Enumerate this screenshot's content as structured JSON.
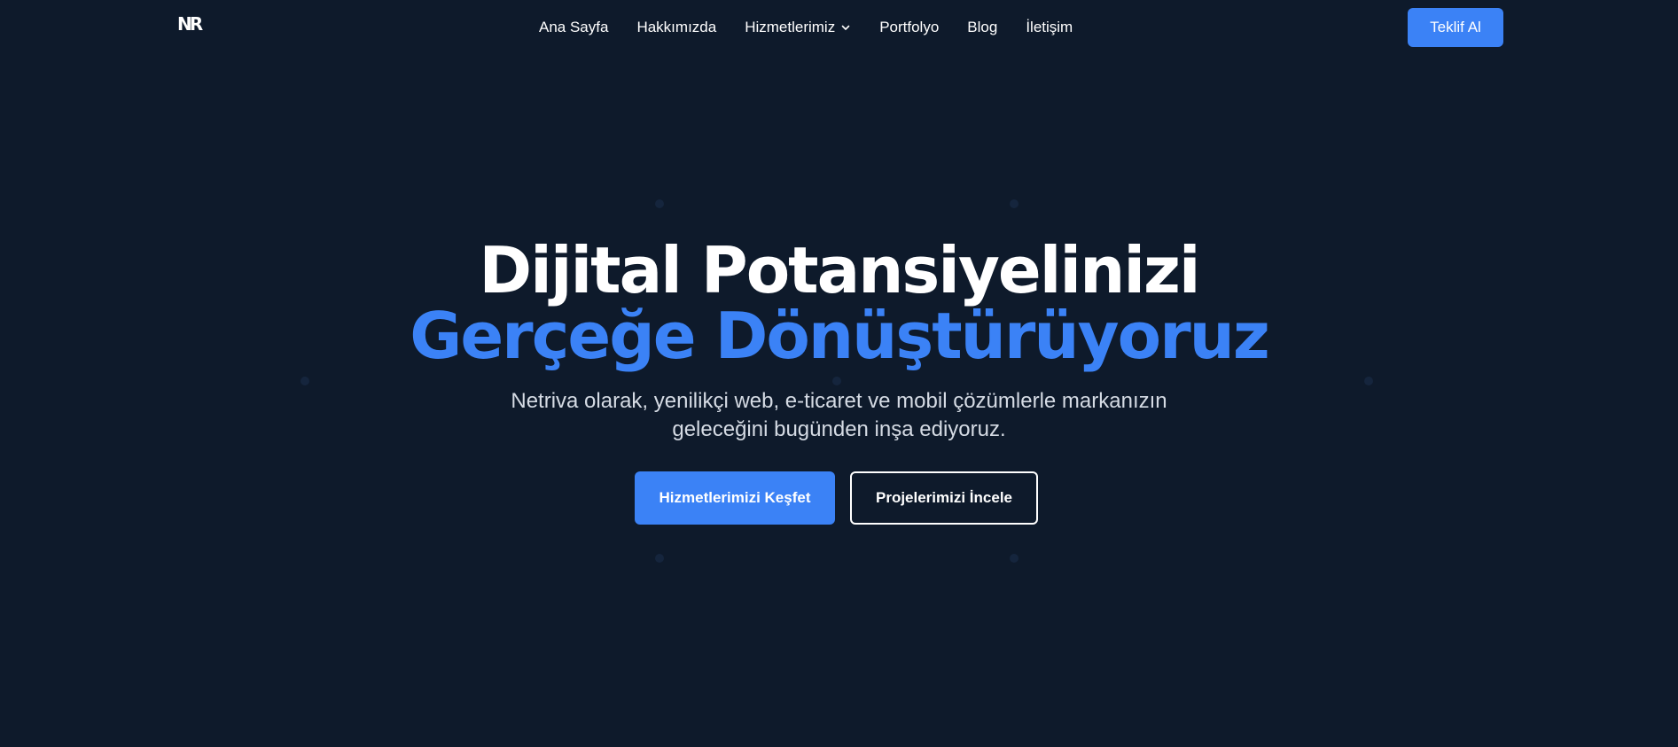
{
  "header": {
    "logo_text": "NR",
    "nav": [
      {
        "label": "Ana Sayfa"
      },
      {
        "label": "Hakkımızda"
      },
      {
        "label": "Hizmetlerimiz"
      },
      {
        "label": "Portfolyo"
      },
      {
        "label": "Blog"
      },
      {
        "label": "İletişim"
      }
    ],
    "cta_label": "Teklif Al"
  },
  "hero": {
    "title_line1": "Dijital Potansiyelinizi",
    "title_line2": "Gerçeğe Dönüştürüyoruz",
    "subtitle_line1": "Netriva olarak, yenilikçi web, e-ticaret ve mobil çözümlerle markanızın",
    "subtitle_line2": "geleceğini bugünden inşa ediyoruz.",
    "primary_button": "Hizmetlerimizi Keşfet",
    "secondary_button": "Projelerimizi İncele"
  },
  "colors": {
    "background": "#0e1a2b",
    "accent": "#3b82f6",
    "text": "#ffffff",
    "subtext": "#d5dbe4"
  }
}
